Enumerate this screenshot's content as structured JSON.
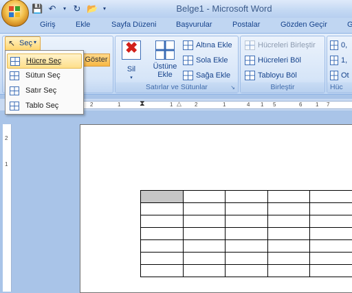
{
  "window": {
    "title": "Belge1 - Microsoft Word"
  },
  "quick_access": {
    "icons": [
      "save-icon",
      "undo-icon",
      "redo-icon",
      "open-icon",
      "customize-icon"
    ]
  },
  "tabs": [
    "Giriş",
    "Ekle",
    "Sayfa Düzeni",
    "Başvurular",
    "Postalar",
    "Gözden Geçir",
    "G"
  ],
  "ribbon": {
    "select_button": "Seç",
    "show_button": "Göster",
    "delete_button": "Sil",
    "insert_above": "Üstüne\nEkle",
    "insert_below": "Altına Ekle",
    "insert_left": "Sola Ekle",
    "insert_right": "Sağa Ekle",
    "group_rows_cols": "Satırlar ve Sütunlar",
    "merge_cells": "Hücreleri Birleştir",
    "split_cells": "Hücreleri Böl",
    "split_table": "Tabloyu Böl",
    "group_merge": "Birleştir",
    "cell_size_label": "Hüc",
    "size_values": [
      "0,",
      "1,"
    ],
    "autofit_label": "Ot"
  },
  "select_menu": {
    "items": [
      "Hücre Seç",
      "Sütun Seç",
      "Satır Seç",
      "Tablo Seç"
    ]
  },
  "ruler": {
    "h_marks": [
      "2",
      "1",
      "1",
      "2",
      "1",
      "4",
      "1",
      "5",
      "6",
      "1",
      "7"
    ],
    "v_marks": [
      "2",
      "1"
    ]
  },
  "document": {
    "table": {
      "rows": 7,
      "cols": 5,
      "selected_cell": [
        0,
        0
      ]
    }
  }
}
